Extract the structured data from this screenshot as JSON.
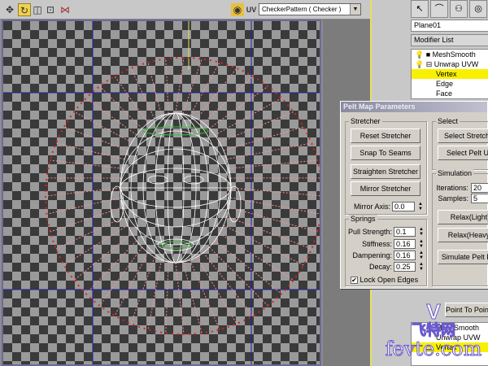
{
  "toolbar": {
    "tools": [
      {
        "name": "move-icon",
        "glyph": "✥"
      },
      {
        "name": "rotate-icon",
        "glyph": "↻"
      },
      {
        "name": "scale-icon",
        "glyph": "◫"
      },
      {
        "name": "freeform-icon",
        "glyph": "⊡"
      },
      {
        "name": "mirror-icon",
        "glyph": "⋈"
      }
    ],
    "uv_label": "UV",
    "texture_dropdown": "CheckerPattern  ( Checker )"
  },
  "command_panel": {
    "object_name": "Plane01",
    "modifier_list": "Modifier List",
    "stack": [
      {
        "label": "MeshSmooth",
        "box": "■"
      },
      {
        "label": "Unwrap UVW",
        "box": "⊟"
      },
      {
        "label": "Vertex"
      },
      {
        "label": "Edge"
      },
      {
        "label": "Face"
      }
    ]
  },
  "dialog": {
    "title": "Pelt Map Parameters",
    "stretcher": {
      "label": "Stretcher",
      "buttons": [
        "Reset Stretcher",
        "Snap To Seams",
        "Straighten Stretcher",
        "Mirror Stretcher"
      ],
      "mirror_axis_label": "Mirror Axis:",
      "mirror_axis": "0.0"
    },
    "springs": {
      "label": "Springs",
      "fields": [
        {
          "label": "Pull Strength:",
          "value": "0.1"
        },
        {
          "label": "Stiffness:",
          "value": "0.16"
        },
        {
          "label": "Dampening:",
          "value": "0.16"
        },
        {
          "label": "Decay:",
          "value": "0.25"
        }
      ],
      "lock_open_edges": "Lock Open Edges",
      "lock_checked": true
    },
    "select": {
      "label": "Select",
      "buttons": [
        "Select Stretcher",
        "Select Pelt UV"
      ]
    },
    "simulation": {
      "label": "Simulation",
      "iterations_label": "Iterations:",
      "iterations": "20",
      "samples_label": "Samples:",
      "samples": "5",
      "buttons": [
        "Relax(Light)",
        "Relax(Heavy)",
        "Simulate Pelt Pull"
      ]
    }
  },
  "lower_panel": {
    "button": "Point To Point Seams",
    "stack": [
      "MeshSmooth",
      "Unwrap UVW",
      "Vertex"
    ]
  },
  "watermark": {
    "cn": "飞特网",
    "en": "fevte.com"
  },
  "colors": {
    "highlight": "#f8f000",
    "seam": "#e02020",
    "mesh": "#ffffff"
  }
}
